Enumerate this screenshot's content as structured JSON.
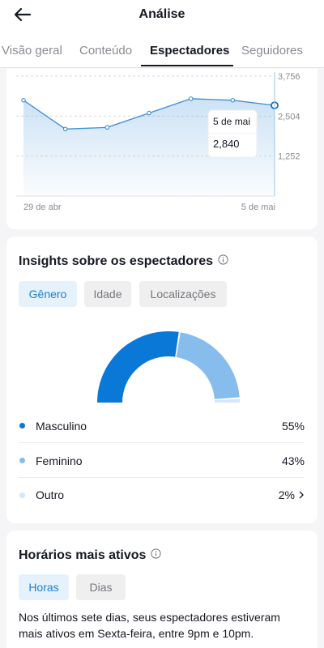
{
  "header": {
    "title": "Análise",
    "tabs": [
      {
        "label": "Visão geral",
        "active": false
      },
      {
        "label": "Conteúdo",
        "active": false
      },
      {
        "label": "Espectadores",
        "active": true
      },
      {
        "label": "Seguidores",
        "active": false
      }
    ]
  },
  "viewers_chart": {
    "tooltip": {
      "date": "5 de mai",
      "value": "2,840"
    },
    "x_start_label": "29 de abr",
    "x_end_label": "5 de mai",
    "y_tick_labels": [
      "3,756",
      "2,504",
      "1,252"
    ]
  },
  "chart_data": {
    "type": "area",
    "x": [
      "29 de abr",
      "30 de abr",
      "1 de mai",
      "2 de mai",
      "3 de mai",
      "4 de mai",
      "5 de mai"
    ],
    "values": [
      3000,
      2100,
      2150,
      2600,
      3050,
      3000,
      2840
    ],
    "ylim": [
      0,
      3756
    ],
    "y_ticks": [
      1252,
      2504,
      3756
    ],
    "grid": true
  },
  "insights": {
    "title": "Insights sobre os espectadores",
    "tabs": [
      {
        "label": "Gênero",
        "active": true
      },
      {
        "label": "Idade",
        "active": false
      },
      {
        "label": "Localizações",
        "active": false
      }
    ],
    "gender": [
      {
        "label": "Masculino",
        "value": "55%",
        "percent": 55,
        "color": "#0a78d7"
      },
      {
        "label": "Feminino",
        "value": "43%",
        "percent": 43,
        "color": "#86bdec"
      },
      {
        "label": "Outro",
        "value": "2%",
        "percent": 2,
        "color": "#d3e7f8"
      }
    ]
  },
  "active_times": {
    "title": "Horários mais ativos",
    "tabs": [
      {
        "label": "Horas",
        "active": true
      },
      {
        "label": "Dias",
        "active": false
      }
    ],
    "description": "Nos últimos sete dias, seus espectadores estiveram mais ativos em Sexta-feira, entre 9pm e 10pm."
  },
  "colors": {
    "accent": "#1a7fd0",
    "line": "#3c8fd6",
    "male": "#0a78d7",
    "female": "#86bdec",
    "other": "#d3e7f8"
  }
}
